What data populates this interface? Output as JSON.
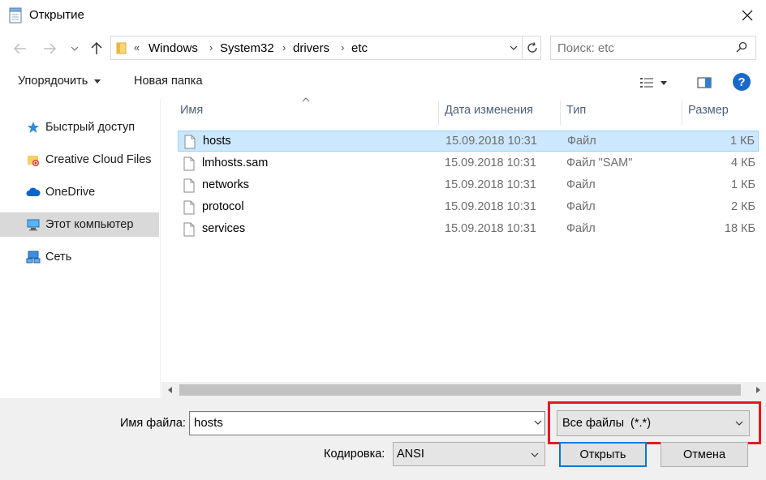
{
  "window": {
    "title": "Открытие"
  },
  "address": {
    "prefix": "«",
    "crumbs": [
      "Windows",
      "System32",
      "drivers",
      "etc"
    ]
  },
  "search": {
    "placeholder": "Поиск: etc"
  },
  "toolbar": {
    "organize_label": "Упорядочить",
    "new_folder_label": "Новая папка"
  },
  "nav": {
    "items": [
      {
        "label": "Быстрый доступ",
        "icon": "star-icon"
      },
      {
        "label": "Creative Cloud Files",
        "icon": "creative-cloud-folder-icon"
      },
      {
        "label": "OneDrive",
        "icon": "cloud-icon"
      },
      {
        "label": "Этот компьютер",
        "icon": "computer-icon",
        "selected": true
      },
      {
        "label": "Сеть",
        "icon": "network-icon"
      }
    ]
  },
  "columns": {
    "name": "Имя",
    "date": "Дата изменения",
    "type": "Тип",
    "size": "Размер"
  },
  "files": [
    {
      "name": "hosts",
      "date": "15.09.2018 10:31",
      "type": "Файл",
      "size": "1 КБ",
      "selected": true
    },
    {
      "name": "lmhosts.sam",
      "date": "15.09.2018 10:31",
      "type": "Файл \"SAM\"",
      "size": "4 КБ"
    },
    {
      "name": "networks",
      "date": "15.09.2018 10:31",
      "type": "Файл",
      "size": "1 КБ"
    },
    {
      "name": "protocol",
      "date": "15.09.2018 10:31",
      "type": "Файл",
      "size": "2 КБ"
    },
    {
      "name": "services",
      "date": "15.09.2018 10:31",
      "type": "Файл",
      "size": "18 КБ"
    }
  ],
  "footer": {
    "filename_label": "Имя файла:",
    "filename_value": "hosts",
    "filetype_value": "Все файлы  (*.*)",
    "encoding_label": "Кодировка:",
    "encoding_value": "ANSI",
    "open_label": "Открыть",
    "cancel_label": "Отмена"
  },
  "colors": {
    "accent": "#0078d7",
    "selection": "#cce8ff",
    "highlight": "#e8171f"
  }
}
